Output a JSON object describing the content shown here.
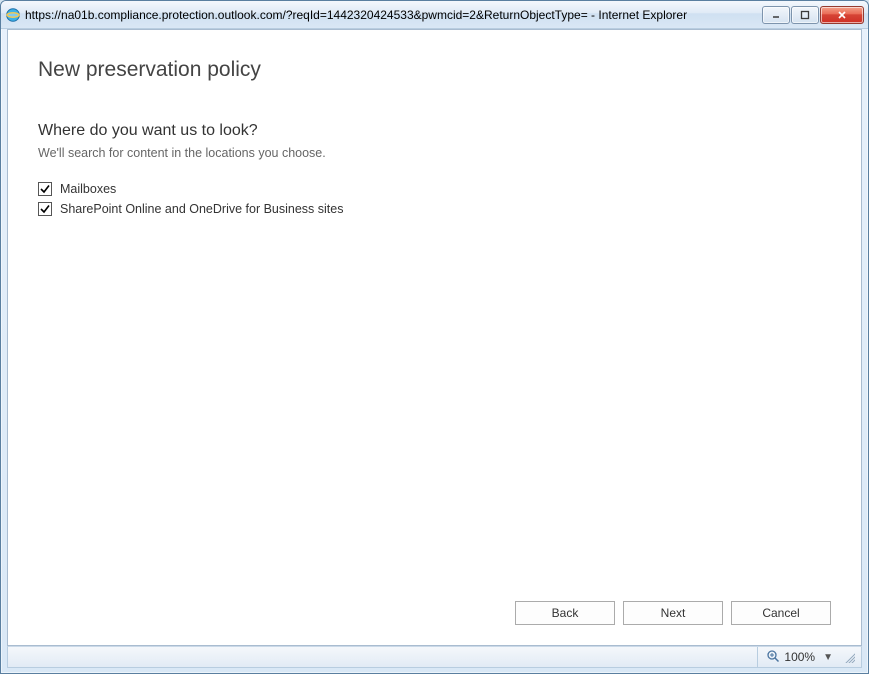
{
  "window": {
    "title": "https://na01b.compliance.protection.outlook.com/?reqId=1442320424533&pwmcid=2&ReturnObjectType= - Internet Explorer"
  },
  "page": {
    "title": "New preservation policy",
    "heading": "Where do you want us to look?",
    "subtext": "We'll search for content in the locations you choose."
  },
  "options": {
    "mailboxes": {
      "label": "Mailboxes",
      "checked": true
    },
    "sharepoint": {
      "label": "SharePoint Online and OneDrive for Business sites",
      "checked": true
    }
  },
  "buttons": {
    "back": "Back",
    "next": "Next",
    "cancel": "Cancel"
  },
  "status": {
    "zoom": "100%"
  }
}
